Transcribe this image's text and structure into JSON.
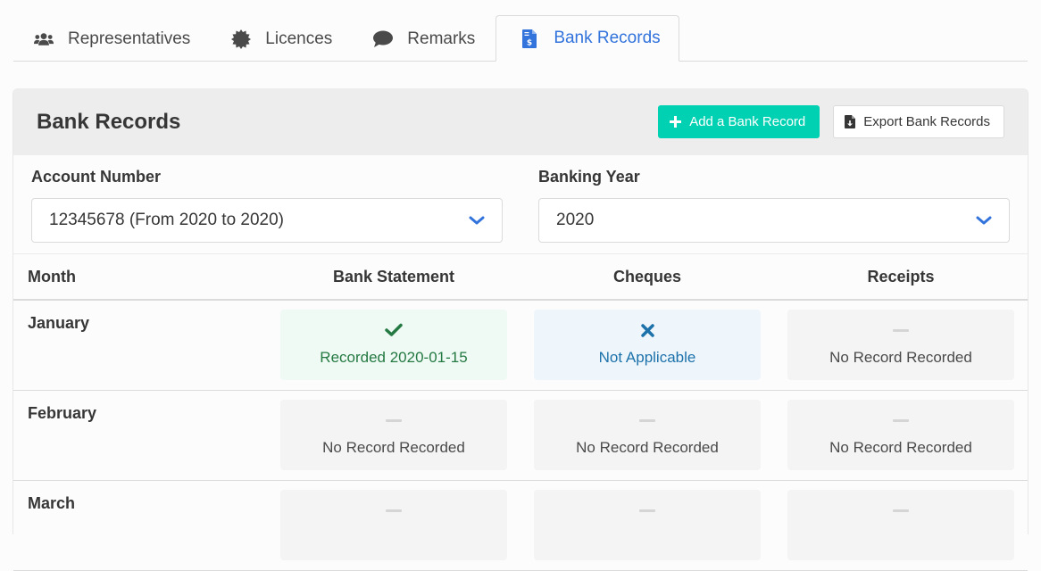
{
  "tabs": [
    {
      "label": "Representatives",
      "icon": "users-icon",
      "active": false
    },
    {
      "label": "Licences",
      "icon": "certificate-icon",
      "active": false
    },
    {
      "label": "Remarks",
      "icon": "comment-icon",
      "active": false
    },
    {
      "label": "Bank Records",
      "icon": "file-invoice-dollar-icon",
      "active": true
    }
  ],
  "panel": {
    "title": "Bank Records",
    "add_button": "Add a Bank Record",
    "export_button": "Export Bank Records"
  },
  "filters": {
    "account": {
      "label": "Account Number",
      "value": "12345678 (From 2020 to 2020)"
    },
    "year": {
      "label": "Banking Year",
      "value": "2020"
    }
  },
  "table": {
    "headers": [
      "Month",
      "Bank Statement",
      "Cheques",
      "Receipts"
    ],
    "rows": [
      {
        "month": "January",
        "cells": [
          {
            "status": "recorded",
            "text": "Recorded 2020-01-15",
            "icon": "check-icon"
          },
          {
            "status": "na",
            "text": "Not Applicable",
            "icon": "times-icon"
          },
          {
            "status": "none",
            "text": "No Record Recorded",
            "icon": "dash-icon"
          }
        ]
      },
      {
        "month": "February",
        "cells": [
          {
            "status": "none",
            "text": "No Record Recorded",
            "icon": "dash-icon"
          },
          {
            "status": "none",
            "text": "No Record Recorded",
            "icon": "dash-icon"
          },
          {
            "status": "none",
            "text": "No Record Recorded",
            "icon": "dash-icon"
          }
        ]
      },
      {
        "month": "March",
        "cells": [
          {
            "status": "none",
            "text": "",
            "icon": "dash-icon"
          },
          {
            "status": "none",
            "text": "",
            "icon": "dash-icon"
          },
          {
            "status": "none",
            "text": "",
            "icon": "dash-icon"
          }
        ]
      }
    ]
  },
  "colors": {
    "accent": "#3273dc",
    "primary": "#00d1b2",
    "success_text": "#257942",
    "info_text": "#1d72aa"
  }
}
